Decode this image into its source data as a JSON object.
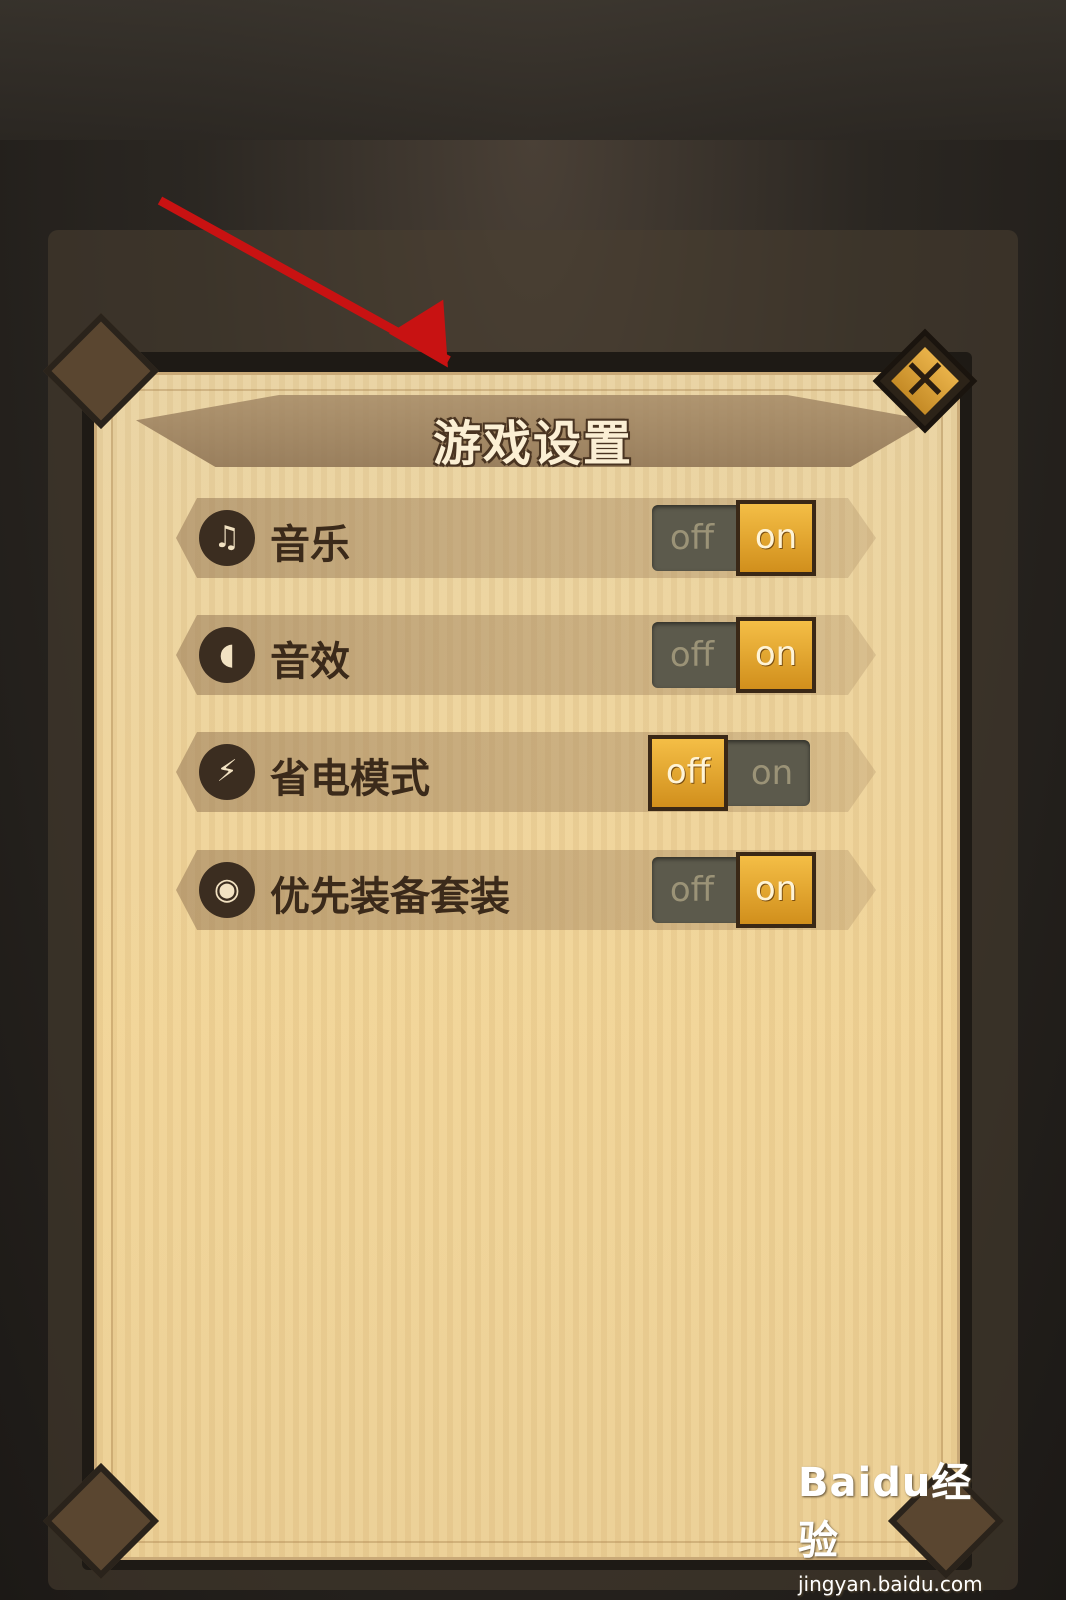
{
  "dialog": {
    "title": "游戏设置",
    "close_icon": "close-icon"
  },
  "settings": [
    {
      "label": "音乐",
      "icon": "music-note-icon",
      "icon_glyph": "♫",
      "off_label": "off",
      "on_label": "on",
      "state": "on"
    },
    {
      "label": "音效",
      "icon": "speaker-icon",
      "icon_glyph": "◖",
      "off_label": "off",
      "on_label": "on",
      "state": "on"
    },
    {
      "label": "省电模式",
      "icon": "lightning-icon",
      "icon_glyph": "⚡",
      "off_label": "off",
      "on_label": "on",
      "state": "off"
    },
    {
      "label": "优先装备套装",
      "icon": "armor-icon",
      "icon_glyph": "◉",
      "off_label": "off",
      "on_label": "on",
      "state": "on"
    }
  ],
  "watermark": {
    "logo_text": "Baidu经验",
    "url": "jingyan.baidu.com"
  },
  "colors": {
    "toggle_active": "#e0a430",
    "annotation_arrow": "#c81212"
  }
}
